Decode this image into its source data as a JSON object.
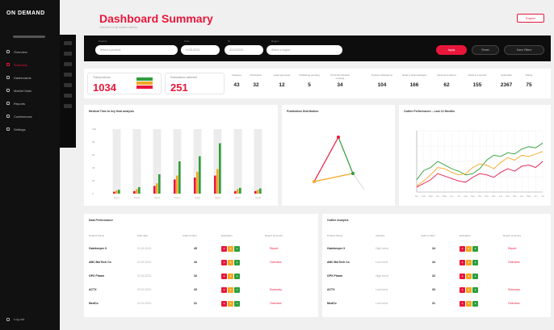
{
  "sidebar": {
    "brand": "ON DEMAND",
    "items": [
      {
        "label": "Overview",
        "active": false
      },
      {
        "label": "Summary",
        "active": true
      },
      {
        "label": "Dashboards",
        "active": false
      },
      {
        "label": "Market Data",
        "active": false
      },
      {
        "label": "Reports",
        "active": false
      },
      {
        "label": "Conferences",
        "active": false
      },
      {
        "label": "Settings",
        "active": false
      }
    ],
    "logout": "Log out"
  },
  "header": {
    "title": "Dashboard Summary",
    "subtitle": "Overview of all market metrics",
    "export_label": "Export"
  },
  "filters": {
    "labels": [
      "Product",
      "From",
      "To",
      "Region"
    ],
    "values": [
      "Select a product",
      "01/01/2021",
      "31/12/2021",
      "Select a region"
    ],
    "apply_label": "Apply",
    "reset_label": "Reset",
    "save_label": "Save Filters"
  },
  "kpis": {
    "big": [
      {
        "label": "Total products",
        "value": "1034"
      },
      {
        "label": "Publications selected",
        "value": "251"
      }
    ],
    "small": [
      {
        "label": "Category",
        "value": "43"
      },
      {
        "label": "Publication",
        "value": "32"
      },
      {
        "label": "Label approved",
        "value": "12"
      },
      {
        "label": "Publishing pending",
        "value": "5"
      },
      {
        "label": "Proximity Medical meeting",
        "value": "34"
      },
      {
        "label": "Posted publications",
        "value": "104"
      },
      {
        "label": "Read & acknowledged",
        "value": "166"
      },
      {
        "label": "Read and shared",
        "value": "62"
      },
      {
        "label": "Read & exported",
        "value": "155"
      },
      {
        "label": "Applicable",
        "value": "2367"
      },
      {
        "label": "Rating",
        "value": "75"
      }
    ],
    "legend_colors": [
      "#2e9e3b",
      "#f5a623",
      "#e8163a"
    ]
  },
  "chart_bar": {
    "title": "Medical Time to key final analysis",
    "chart_data": {
      "type": "bar",
      "categories": [
        "Cat 1",
        "Cat 2",
        "Cat 3",
        "Cat 4",
        "Cat 5",
        "Cat 6",
        "Cat 7",
        "Cat 8"
      ],
      "ylim": [
        0,
        100
      ],
      "yticks": [
        "100",
        "80",
        "60",
        "40",
        "20",
        "0"
      ],
      "series": [
        {
          "color": "#e8163a",
          "values": [
            3,
            4,
            12,
            22,
            25,
            28,
            4,
            4
          ]
        },
        {
          "color": "#f5a623",
          "values": [
            5,
            7,
            16,
            28,
            34,
            38,
            7,
            6
          ]
        },
        {
          "color": "#2e9e3b",
          "values": [
            6,
            10,
            30,
            50,
            58,
            78,
            9,
            8
          ]
        }
      ],
      "background_max": 100
    }
  },
  "chart_tri": {
    "title": "Publication Distribution"
  },
  "chart_line": {
    "title": "Outlier Performance – Last 12 Months",
    "chart_data": {
      "type": "line",
      "x": [
        "Jan",
        "Feb",
        "Mar",
        "Apr",
        "May",
        "Jun",
        "Jul",
        "Aug",
        "Sep",
        "Oct",
        "Nov",
        "Dec",
        "Jan",
        "Feb",
        "Mar",
        "Apr",
        "May",
        "Jun",
        "Jul"
      ],
      "ylim": [
        0,
        100
      ],
      "series": [
        {
          "color": "#2e9e3b",
          "values": [
            20,
            35,
            40,
            50,
            44,
            38,
            34,
            28,
            30,
            38,
            52,
            60,
            58,
            64,
            62,
            70,
            74,
            72,
            80
          ]
        },
        {
          "color": "#f5a623",
          "values": [
            10,
            18,
            28,
            40,
            38,
            32,
            28,
            30,
            40,
            46,
            44,
            38,
            48,
            56,
            52,
            60,
            58,
            62,
            66
          ]
        },
        {
          "color": "#e8164e",
          "values": [
            8,
            14,
            20,
            30,
            26,
            22,
            18,
            16,
            24,
            30,
            28,
            24,
            32,
            38,
            34,
            42,
            44,
            40,
            50
          ]
        }
      ]
    }
  },
  "table_left": {
    "title": "Data Performance",
    "headers": [
      "Product Name",
      "Start date",
      "Audit number",
      "Evaluation",
      "Report summary"
    ],
    "rows": [
      {
        "name": "Gatekeeper X",
        "date": "01.04.2021",
        "num": "45",
        "link": "Report"
      },
      {
        "name": "ABC BioTech Co",
        "date": "01.04.2021",
        "num": "34",
        "link": "Overview"
      },
      {
        "name": "GPX Pharm",
        "date": "02.04.2021",
        "num": "32",
        "link": ""
      },
      {
        "name": "ACTX",
        "date": "03.04.2021",
        "num": "33",
        "link": "Summary"
      },
      {
        "name": "MedCo",
        "date": "04.04.2021",
        "num": "31",
        "link": "Overview"
      }
    ]
  },
  "table_right": {
    "title": "Outlier Analysis",
    "headers": [
      "Product Name",
      "Indicator",
      "Audit number",
      "Evaluation",
      "Report summary"
    ],
    "rows": [
      {
        "name": "Gatekeeper X",
        "date": "High trend",
        "num": "34",
        "link": "Report"
      },
      {
        "name": "ABC BioTech Co",
        "date": "Low trend",
        "num": "34",
        "link": "Overview"
      },
      {
        "name": "GPX Pharm",
        "date": "High trend",
        "num": "32",
        "link": ""
      },
      {
        "name": "ACTX",
        "date": "Low trend",
        "num": "33",
        "link": "Summary"
      },
      {
        "name": "MedCo",
        "date": "Low trend",
        "num": "31",
        "link": "Overview"
      }
    ]
  },
  "eval_tags": [
    "●",
    "●",
    "●"
  ]
}
